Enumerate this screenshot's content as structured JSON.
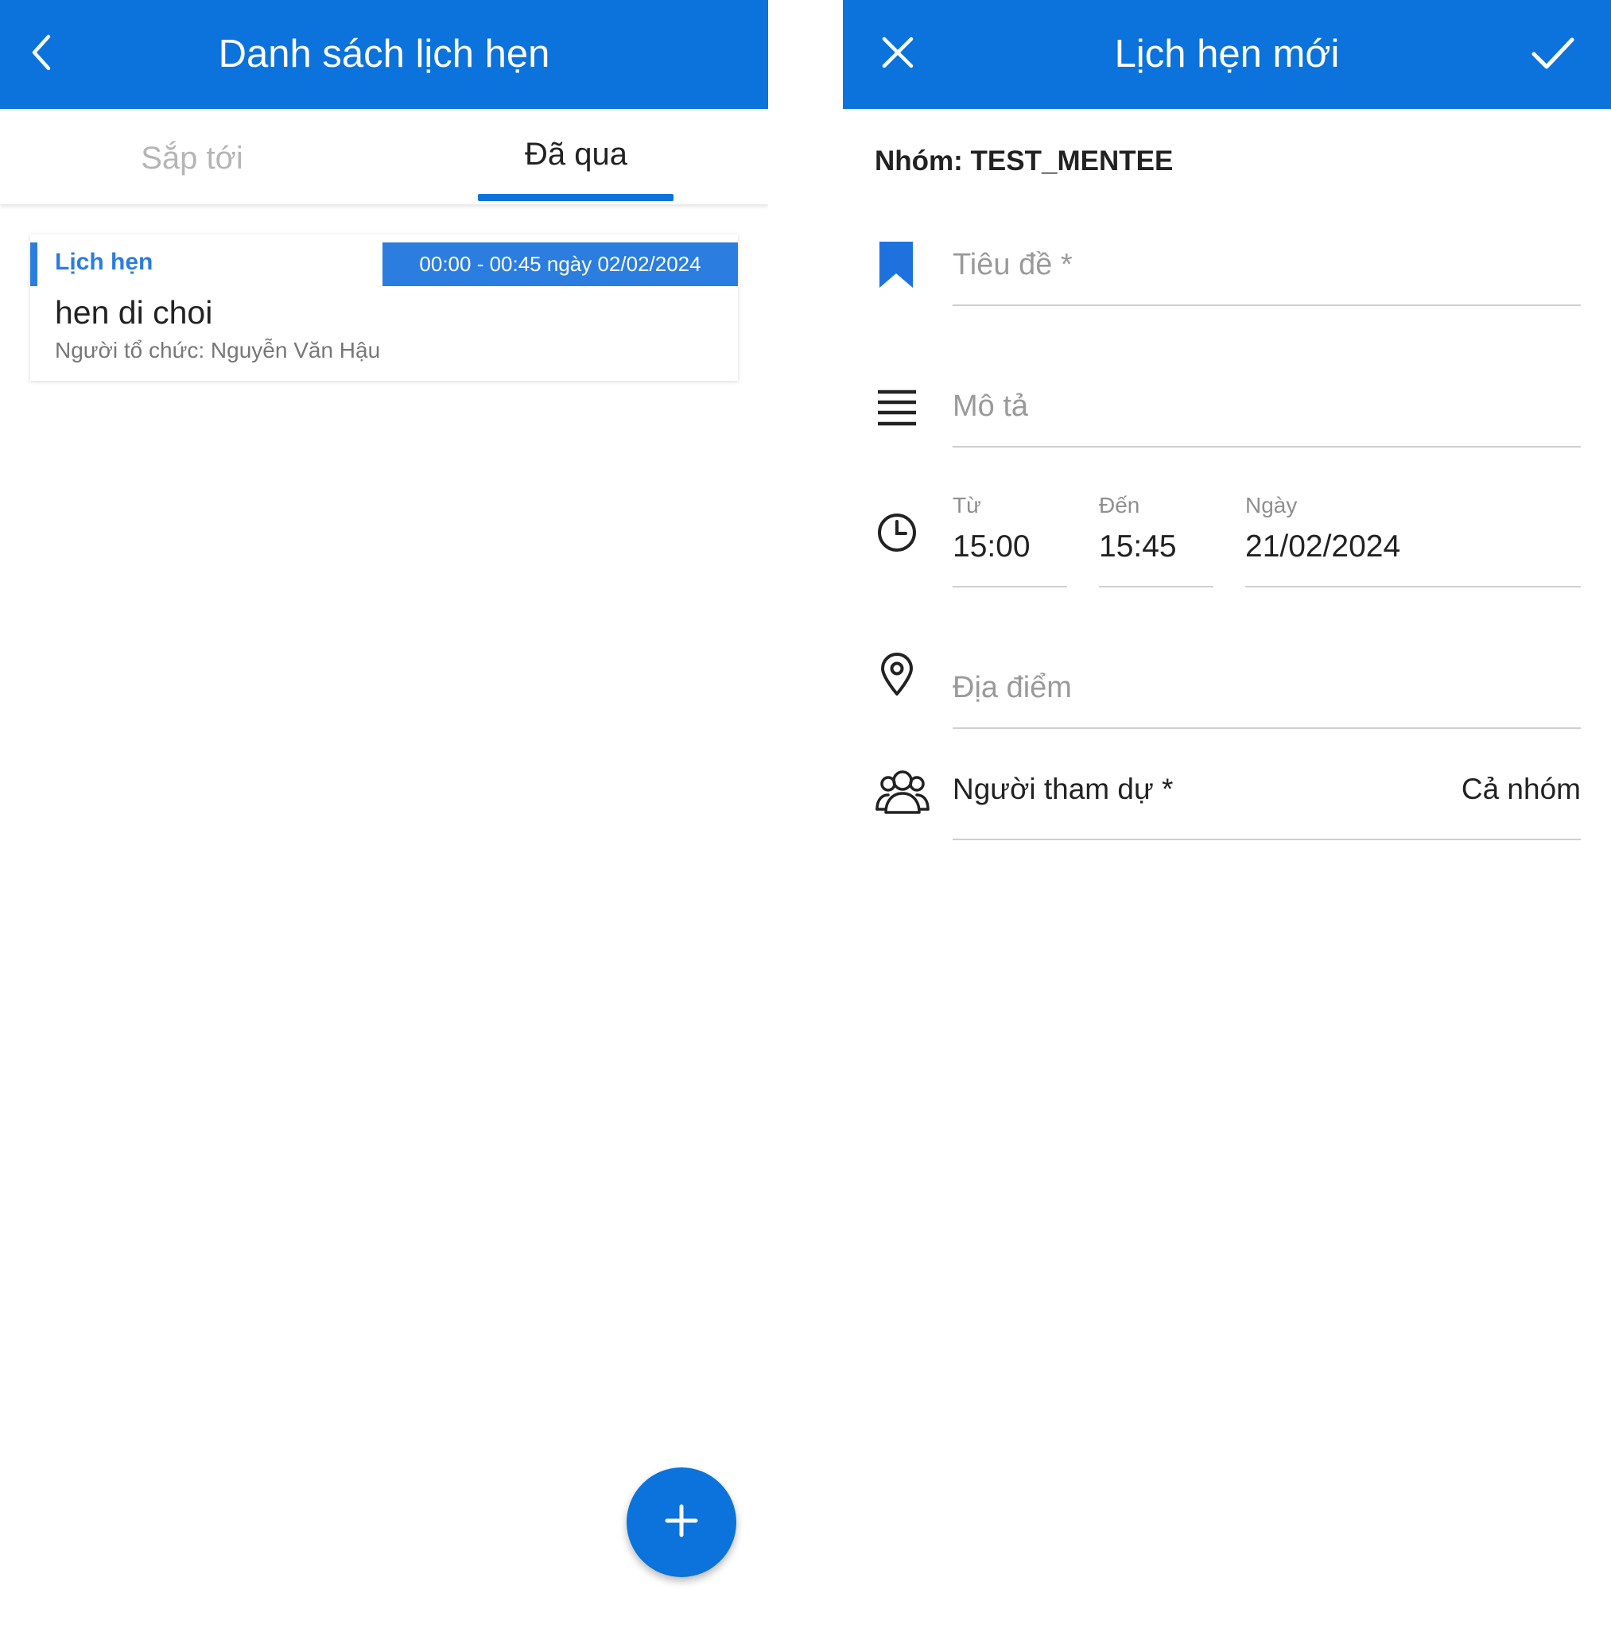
{
  "colors": {
    "primary": "#0b73db",
    "accent_blue": "#2b7de0",
    "text": "#222222",
    "muted": "#9a9a9a"
  },
  "left": {
    "appbar": {
      "title": "Danh sách lịch hẹn",
      "back_icon": "chevron-left-icon"
    },
    "tabs": [
      {
        "label": "Sắp tới",
        "active": false
      },
      {
        "label": "Đã qua",
        "active": true
      }
    ],
    "appointments": [
      {
        "type": "Lịch hẹn",
        "time": "00:00 - 00:45 ngày 02/02/2024",
        "title": "hen di choi",
        "organizer": "Người tổ chức: Nguyễn Văn Hậu"
      }
    ],
    "fab_icon": "plus-icon"
  },
  "right": {
    "appbar": {
      "title": "Lịch hẹn mới",
      "close_icon": "close-icon",
      "confirm_icon": "check-icon"
    },
    "group_label": "Nhóm: TEST_MENTEE",
    "title_field": {
      "placeholder": "Tiêu đề *",
      "value": ""
    },
    "description_field": {
      "placeholder": "Mô tả",
      "value": ""
    },
    "time": {
      "from_label": "Từ",
      "from_value": "15:00",
      "to_label": "Đến",
      "to_value": "15:45",
      "date_label": "Ngày",
      "date_value": "21/02/2024"
    },
    "location_field": {
      "placeholder": "Địa điểm",
      "value": ""
    },
    "attendees": {
      "label": "Người tham dự *",
      "value": "Cả nhóm"
    }
  }
}
